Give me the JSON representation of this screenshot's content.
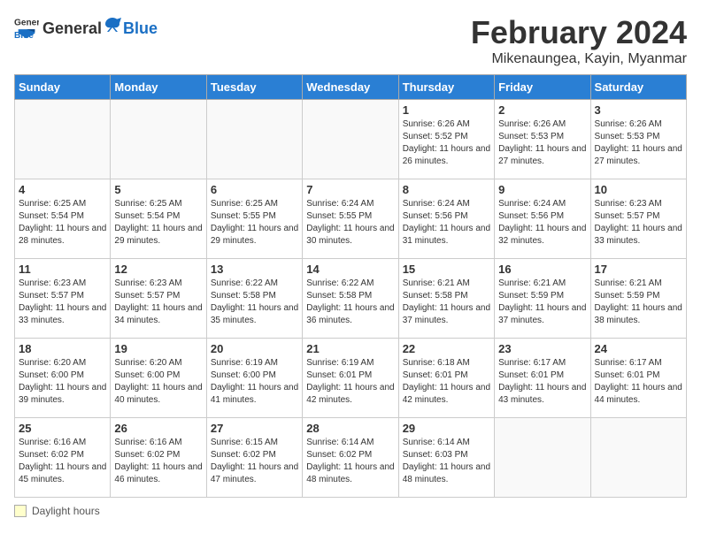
{
  "header": {
    "logo_general": "General",
    "logo_blue": "Blue",
    "month_title": "February 2024",
    "location": "Mikenaungea, Kayin, Myanmar"
  },
  "days_of_week": [
    "Sunday",
    "Monday",
    "Tuesday",
    "Wednesday",
    "Thursday",
    "Friday",
    "Saturday"
  ],
  "footer": {
    "daylight_label": "Daylight hours"
  },
  "weeks": [
    [
      {
        "day": "",
        "info": ""
      },
      {
        "day": "",
        "info": ""
      },
      {
        "day": "",
        "info": ""
      },
      {
        "day": "",
        "info": ""
      },
      {
        "day": "1",
        "info": "Sunrise: 6:26 AM\nSunset: 5:52 PM\nDaylight: 11 hours and 26 minutes."
      },
      {
        "day": "2",
        "info": "Sunrise: 6:26 AM\nSunset: 5:53 PM\nDaylight: 11 hours and 27 minutes."
      },
      {
        "day": "3",
        "info": "Sunrise: 6:26 AM\nSunset: 5:53 PM\nDaylight: 11 hours and 27 minutes."
      }
    ],
    [
      {
        "day": "4",
        "info": "Sunrise: 6:25 AM\nSunset: 5:54 PM\nDaylight: 11 hours and 28 minutes."
      },
      {
        "day": "5",
        "info": "Sunrise: 6:25 AM\nSunset: 5:54 PM\nDaylight: 11 hours and 29 minutes."
      },
      {
        "day": "6",
        "info": "Sunrise: 6:25 AM\nSunset: 5:55 PM\nDaylight: 11 hours and 29 minutes."
      },
      {
        "day": "7",
        "info": "Sunrise: 6:24 AM\nSunset: 5:55 PM\nDaylight: 11 hours and 30 minutes."
      },
      {
        "day": "8",
        "info": "Sunrise: 6:24 AM\nSunset: 5:56 PM\nDaylight: 11 hours and 31 minutes."
      },
      {
        "day": "9",
        "info": "Sunrise: 6:24 AM\nSunset: 5:56 PM\nDaylight: 11 hours and 32 minutes."
      },
      {
        "day": "10",
        "info": "Sunrise: 6:23 AM\nSunset: 5:57 PM\nDaylight: 11 hours and 33 minutes."
      }
    ],
    [
      {
        "day": "11",
        "info": "Sunrise: 6:23 AM\nSunset: 5:57 PM\nDaylight: 11 hours and 33 minutes."
      },
      {
        "day": "12",
        "info": "Sunrise: 6:23 AM\nSunset: 5:57 PM\nDaylight: 11 hours and 34 minutes."
      },
      {
        "day": "13",
        "info": "Sunrise: 6:22 AM\nSunset: 5:58 PM\nDaylight: 11 hours and 35 minutes."
      },
      {
        "day": "14",
        "info": "Sunrise: 6:22 AM\nSunset: 5:58 PM\nDaylight: 11 hours and 36 minutes."
      },
      {
        "day": "15",
        "info": "Sunrise: 6:21 AM\nSunset: 5:58 PM\nDaylight: 11 hours and 37 minutes."
      },
      {
        "day": "16",
        "info": "Sunrise: 6:21 AM\nSunset: 5:59 PM\nDaylight: 11 hours and 37 minutes."
      },
      {
        "day": "17",
        "info": "Sunrise: 6:21 AM\nSunset: 5:59 PM\nDaylight: 11 hours and 38 minutes."
      }
    ],
    [
      {
        "day": "18",
        "info": "Sunrise: 6:20 AM\nSunset: 6:00 PM\nDaylight: 11 hours and 39 minutes."
      },
      {
        "day": "19",
        "info": "Sunrise: 6:20 AM\nSunset: 6:00 PM\nDaylight: 11 hours and 40 minutes."
      },
      {
        "day": "20",
        "info": "Sunrise: 6:19 AM\nSunset: 6:00 PM\nDaylight: 11 hours and 41 minutes."
      },
      {
        "day": "21",
        "info": "Sunrise: 6:19 AM\nSunset: 6:01 PM\nDaylight: 11 hours and 42 minutes."
      },
      {
        "day": "22",
        "info": "Sunrise: 6:18 AM\nSunset: 6:01 PM\nDaylight: 11 hours and 42 minutes."
      },
      {
        "day": "23",
        "info": "Sunrise: 6:17 AM\nSunset: 6:01 PM\nDaylight: 11 hours and 43 minutes."
      },
      {
        "day": "24",
        "info": "Sunrise: 6:17 AM\nSunset: 6:01 PM\nDaylight: 11 hours and 44 minutes."
      }
    ],
    [
      {
        "day": "25",
        "info": "Sunrise: 6:16 AM\nSunset: 6:02 PM\nDaylight: 11 hours and 45 minutes."
      },
      {
        "day": "26",
        "info": "Sunrise: 6:16 AM\nSunset: 6:02 PM\nDaylight: 11 hours and 46 minutes."
      },
      {
        "day": "27",
        "info": "Sunrise: 6:15 AM\nSunset: 6:02 PM\nDaylight: 11 hours and 47 minutes."
      },
      {
        "day": "28",
        "info": "Sunrise: 6:14 AM\nSunset: 6:02 PM\nDaylight: 11 hours and 48 minutes."
      },
      {
        "day": "29",
        "info": "Sunrise: 6:14 AM\nSunset: 6:03 PM\nDaylight: 11 hours and 48 minutes."
      },
      {
        "day": "",
        "info": ""
      },
      {
        "day": "",
        "info": ""
      }
    ]
  ]
}
